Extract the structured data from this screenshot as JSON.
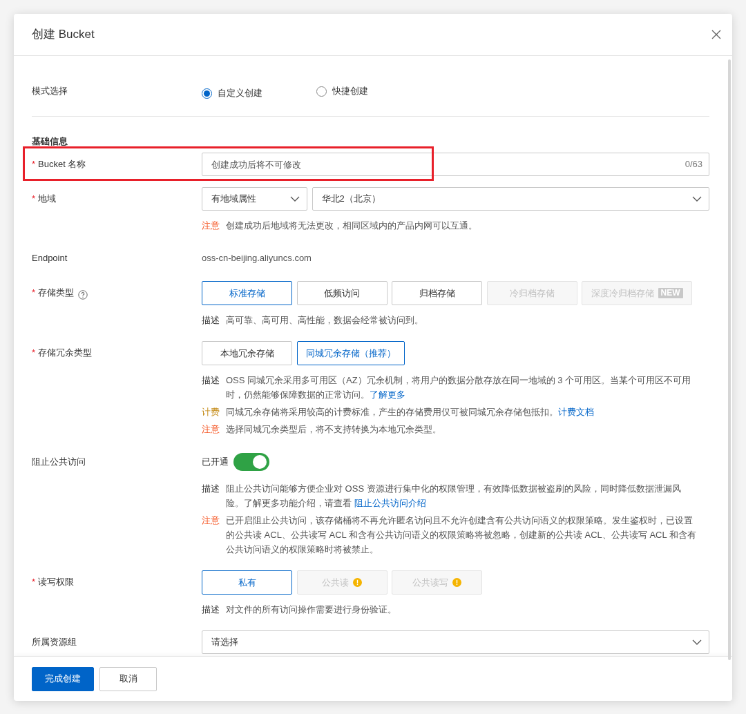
{
  "dialog": {
    "title": "创建 Bucket"
  },
  "rows": [
    {
      "kind": "radio",
      "label": "模式选择",
      "options": [
        {
          "label": "自定义创建",
          "selected": true
        },
        {
          "label": "快捷创建",
          "selected": false
        }
      ]
    },
    {
      "kind": "divider"
    },
    {
      "kind": "heading",
      "label": "基础信息"
    },
    {
      "kind": "input",
      "mark": "*",
      "label": "Bucket 名称",
      "placeholder": "创建成功后将不可修改",
      "counter": "0/63",
      "highlighted": true
    },
    {
      "kind": "selects",
      "mark": "*",
      "label": "地域",
      "selects": [
        {
          "value": "有地域属性"
        },
        {
          "value": "华北2（北京）"
        }
      ],
      "notes": [
        {
          "tag": "注意",
          "kind": "warning",
          "text": "创建成功后地域将无法更改，相同区域内的产品内网可以互通。"
        }
      ]
    },
    {
      "kind": "text",
      "label": "Endpoint",
      "value": "oss-cn-beijing.aliyuncs.com"
    },
    {
      "kind": "buttons",
      "mark": "*",
      "label": "存储类型",
      "help": true,
      "options": [
        {
          "label": "标准存储",
          "selected": true,
          "disabled": false
        },
        {
          "label": "低频访问",
          "selected": false,
          "disabled": false
        },
        {
          "label": "归档存储",
          "selected": false,
          "disabled": false
        },
        {
          "label": "冷归档存储",
          "selected": false,
          "disabled": true
        },
        {
          "label": "深度冷归档存储",
          "selected": false,
          "disabled": true,
          "badge": "NEW"
        }
      ],
      "notes": [
        {
          "tag": "描述",
          "kind": "info",
          "text": "高可靠、高可用、高性能，数据会经常被访问到。"
        }
      ]
    },
    {
      "kind": "buttons",
      "mark": "*",
      "label": "存储冗余类型",
      "options": [
        {
          "label": "本地冗余存储",
          "selected": false,
          "disabled": false
        },
        {
          "label": "同城冗余存储（推荐）",
          "selected": true,
          "disabled": false
        }
      ],
      "notes": [
        {
          "tag": "描述",
          "kind": "info",
          "text": "OSS 同城冗余采用多可用区（AZ）冗余机制，将用户的数据分散存放在同一地域的 3 个可用区。当某个可用区不可用时，仍然能够保障数据的正常访问。",
          "link": "了解更多"
        },
        {
          "tag": "计费",
          "kind": "billing",
          "text": "同城冗余存储将采用较高的计费标准，产生的存储费用仅可被同城冗余存储包抵扣。",
          "link": "计费文档"
        },
        {
          "tag": "注意",
          "kind": "warning",
          "text": "选择同城冗余类型后，将不支持转换为本地冗余类型。"
        }
      ]
    },
    {
      "kind": "switch",
      "label": "阻止公共访问",
      "state_text": "已开通",
      "on": true,
      "notes": [
        {
          "tag": "描述",
          "kind": "info",
          "text": "阻止公共访问能够方便企业对 OSS 资源进行集中化的权限管理，有效降低数据被盗刷的风险，同时降低数据泄漏风险。了解更多功能介绍，请查看 ",
          "link": "阻止公共访问介绍"
        },
        {
          "tag": "注意",
          "kind": "warning",
          "text": "已开启阻止公共访问，该存储桶将不再允许匿名访问且不允许创建含有公共访问语义的权限策略。发生鉴权时，已设置的公共读 ACL、公共读写 ACL 和含有公共访问语义的权限策略将被忽略，创建新的公共读 ACL、公共读写 ACL 和含有公共访问语义的权限策略时将被禁止。"
        }
      ]
    },
    {
      "kind": "buttons",
      "mark": "*",
      "label": "读写权限",
      "options": [
        {
          "label": "私有",
          "selected": true,
          "disabled": false
        },
        {
          "label": "公共读",
          "selected": false,
          "disabled": true,
          "warn": true
        },
        {
          "label": "公共读写",
          "selected": false,
          "disabled": true,
          "warn": true
        }
      ],
      "notes": [
        {
          "tag": "描述",
          "kind": "info",
          "text": "对文件的所有访问操作需要进行身份验证。"
        }
      ]
    },
    {
      "kind": "select",
      "label": "所属资源组",
      "placeholder": "请选择"
    }
  ],
  "footer": {
    "buttons": [
      {
        "label": "完成创建",
        "primary": true
      },
      {
        "label": "取消",
        "primary": false
      }
    ]
  }
}
